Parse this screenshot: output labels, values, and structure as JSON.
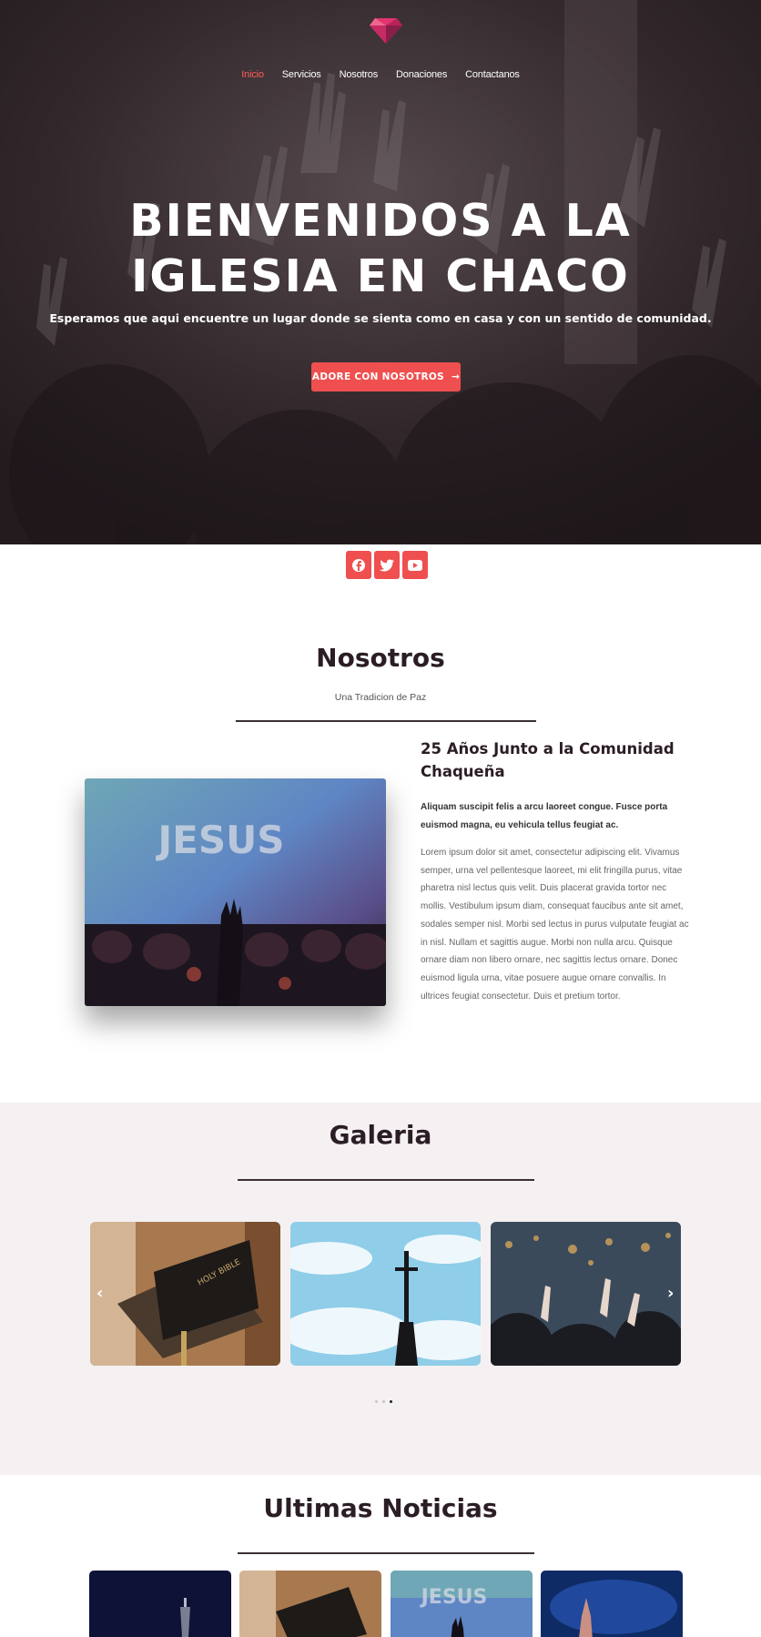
{
  "nav": {
    "items": [
      "Inicio",
      "Servicios",
      "Nosotros",
      "Donaciones",
      "Contactanos"
    ],
    "active": "Inicio"
  },
  "hero": {
    "title_line1": "BIENVENIDOS A LA",
    "title_line2": "IGLESIA EN CHACO",
    "subtitle": "Esperamos que aqui encuentre un lugar donde se sienta como en casa y con un sentido de comunidad.",
    "cta_label": "ADORE CON NOSOTROS",
    "cta_arrow": "→"
  },
  "social": [
    "facebook-icon",
    "twitter-icon",
    "youtube-icon"
  ],
  "nosotros": {
    "title": "Nosotros",
    "subtitle": "Una Tradicion de Paz",
    "heading": "25 Años Junto a la Comunidad Chaqueña",
    "lead": "Aliquam suscipit felis a arcu laoreet congue. Fusce porta euismod magna, eu vehicula tellus feugiat ac.",
    "body": "Lorem ipsum dolor sit amet, consectetur adipiscing elit. Vivamus semper, urna vel pellentesque laoreet, mi elit fringilla purus, vitae pharetra nisl lectus quis velit. Duis placerat gravida tortor nec mollis. Vestibulum ipsum diam, consequat faucibus ante sit amet, sodales semper nisl. Morbi sed lectus in purus vulputate feugiat ac in nisl. Nullam et sagittis augue. Morbi non nulla arcu. Quisque ornare diam non libero ornare, nec sagittis lectus ornare. Donec euismod ligula urna, vitae posuere augue ornare convallis. In ultrices feugiat consectetur. Duis et pretium tortor.",
    "image_text": "JESUS"
  },
  "galeria": {
    "title": "Galeria",
    "prev": "‹",
    "next": "›",
    "slides": [
      "bible-photo",
      "cross-sky-photo",
      "worship-crowd-photo"
    ],
    "active_dot": 3,
    "dot_count": 3
  },
  "noticias": {
    "title": "Ultimas Noticias",
    "thumb_text": "JESUS"
  },
  "colors": {
    "accent": "#ef4f4f",
    "nav_active": "#ff5a5a",
    "heading": "#2b1d25",
    "galeria_bg": "#f5f1f2"
  }
}
